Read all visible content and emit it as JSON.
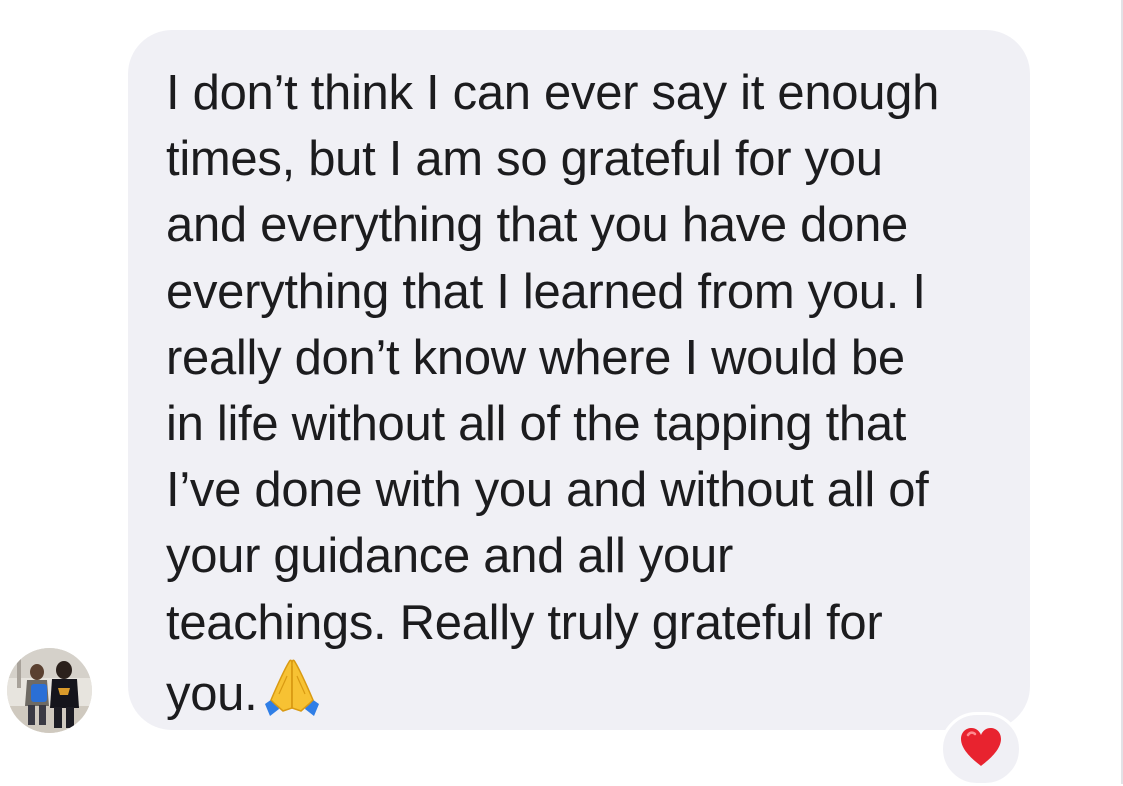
{
  "conversation": {
    "message": {
      "text": "I don’t think I can ever say it enough\ntimes, but I am so grateful for you\nand everything that you have done\neverything that I learned from you. I\nreally don’t know where I would be\nin life without all of the tapping that\nI’ve done with you and without all of\nyour guidance and all your\nteachings. Really truly grateful for\nyou.",
      "emoji": "folded-hands-icon",
      "sender_avatar": "avatar"
    },
    "reaction": {
      "emoji": "red-heart-icon"
    }
  },
  "colors": {
    "bubble_bg": "#f0f0f5",
    "text": "#1c1c1e",
    "heart": "#e8232f",
    "prayer_hands": "#f7c233"
  }
}
